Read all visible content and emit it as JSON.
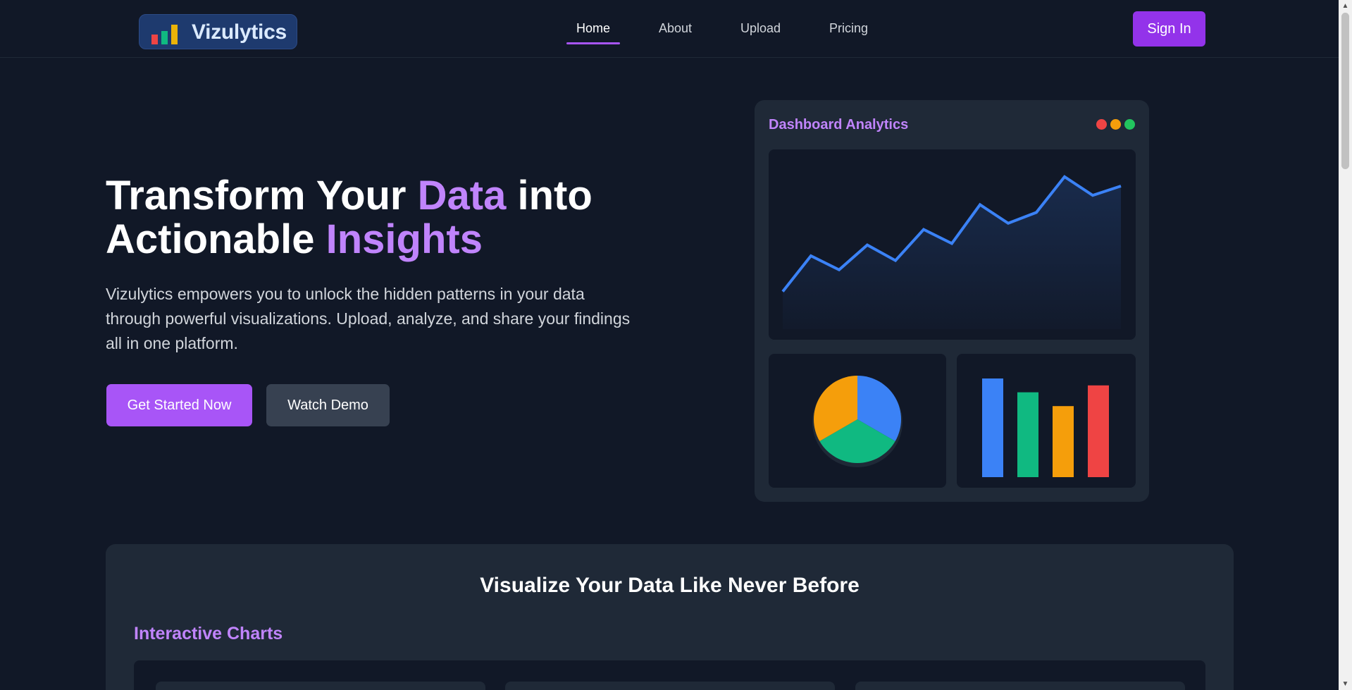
{
  "brand": {
    "name": "Vizulytics",
    "icon": "bar-chart-logo-icon"
  },
  "nav": {
    "items": [
      {
        "label": "Home",
        "active": true
      },
      {
        "label": "About",
        "active": false
      },
      {
        "label": "Upload",
        "active": false
      },
      {
        "label": "Pricing",
        "active": false
      }
    ],
    "signin_label": "Sign In"
  },
  "hero": {
    "title_part1": "Transform Your ",
    "title_accent1": "Data",
    "title_part2": " into",
    "title_part3": "Actionable ",
    "title_accent2": "Insights",
    "description": "Vizulytics empowers you to unlock the hidden patterns in your data through powerful visualizations. Upload, analyze, and share your findings all in one platform.",
    "primary_cta": "Get Started Now",
    "secondary_cta": "Watch Demo"
  },
  "dashboard": {
    "title": "Dashboard Analytics",
    "window_dots": [
      "#ef4444",
      "#f59e0b",
      "#22c55e"
    ]
  },
  "chart_data": [
    {
      "type": "line",
      "color": "#3b82f6",
      "values": [
        22,
        45,
        36,
        52,
        42,
        62,
        53,
        78,
        66,
        73,
        96,
        84,
        90
      ],
      "ylim": [
        0,
        100
      ]
    },
    {
      "type": "pie",
      "slices": [
        {
          "value": 33.3,
          "color": "#3b82f6"
        },
        {
          "value": 33.3,
          "color": "#10b981"
        },
        {
          "value": 33.3,
          "color": "#f59e0b"
        }
      ]
    },
    {
      "type": "bar",
      "values": [
        100,
        86,
        72,
        93
      ],
      "colors": [
        "#3b82f6",
        "#10b981",
        "#f59e0b",
        "#ef4444"
      ],
      "ylim": [
        0,
        100
      ]
    }
  ],
  "features": {
    "title": "Visualize Your Data Like Never Before",
    "subtitle": "Interactive Charts"
  }
}
